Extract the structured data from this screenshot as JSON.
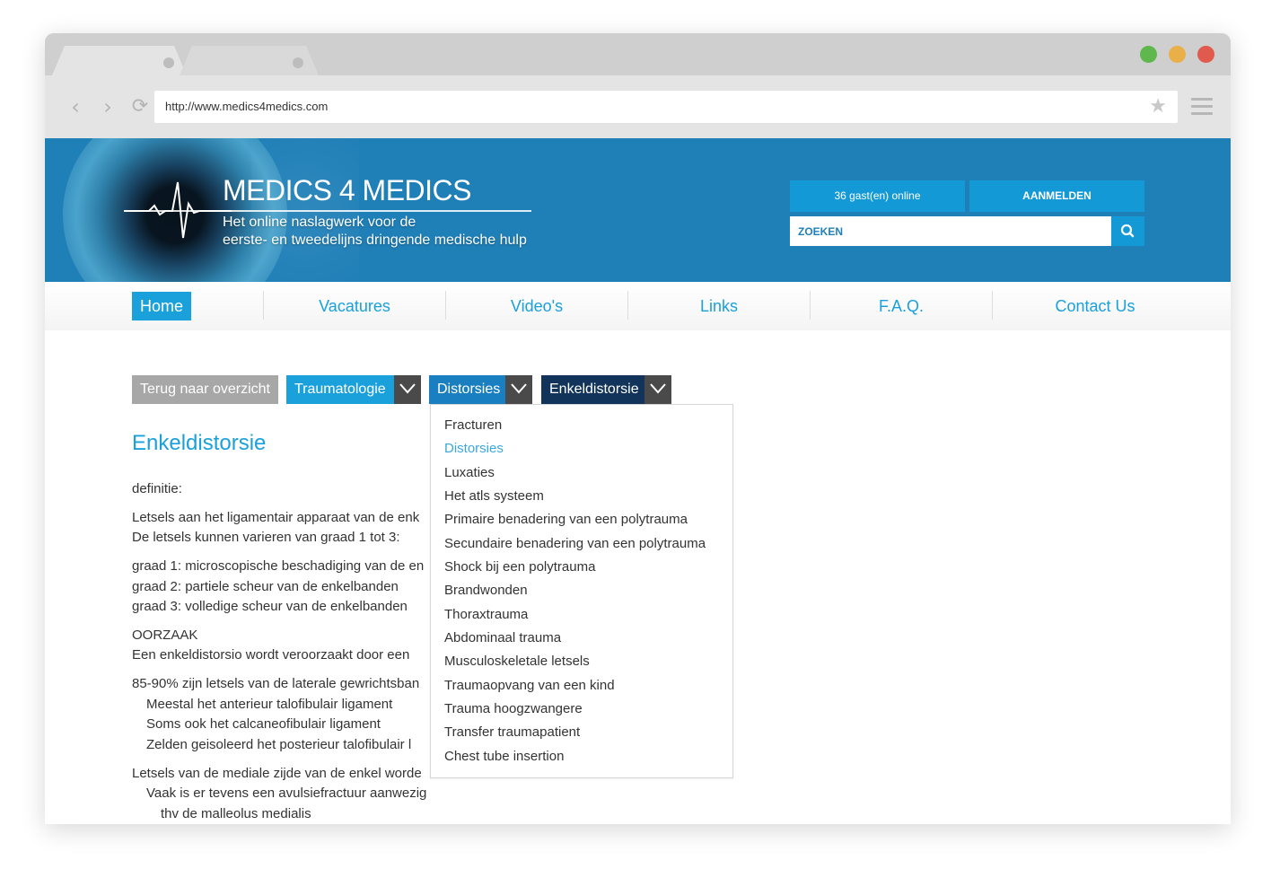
{
  "browser": {
    "url": "http://www.medics4medics.com",
    "traffic_lights": [
      "#5fb84e",
      "#e9b04a",
      "#e05a4d"
    ]
  },
  "header": {
    "logo_title": "MEDICS 4 MEDICS",
    "tagline_line1": "Het online naslagwerk voor de",
    "tagline_line2": "eerste- en tweedelijns dringende medische hulp",
    "guests_online": "36 gast(en) online",
    "login_label": "AANMELDEN",
    "search_placeholder": "ZOEKEN",
    "colors": {
      "bar": "#1f7fb7",
      "accent": "#1399d6"
    }
  },
  "nav": {
    "items": [
      "Home",
      "Vacatures",
      "Video's",
      "Links",
      "F.A.Q.",
      "Contact Us"
    ],
    "active": "Home"
  },
  "breadcrumbs": {
    "back": "Terug naar overzicht",
    "level1": "Traumatologie",
    "level2": "Distorsies",
    "level3": "Enkeldistorsie"
  },
  "dropdown": {
    "selected": "Distorsies",
    "options": [
      "Fracturen",
      "Distorsies",
      "Luxaties",
      "Het atls systeem",
      "Primaire benadering van een polytrauma",
      "Secundaire benadering van een polytrauma",
      "Shock bij een polytrauma",
      "Brandwonden",
      "Thoraxtrauma",
      "Abdominaal trauma",
      "Musculoskeletale letsels",
      "Traumaopvang van een kind",
      "Trauma hoogzwangere",
      "Transfer traumapatient",
      "Chest tube insertion"
    ]
  },
  "article": {
    "title": "Enkeldistorsie",
    "definitie_label": "definitie:",
    "p1_line1": "Letsels aan het ligamentair apparaat van de enk",
    "p1_line2": "De letsels kunnen varieren van graad 1 tot 3:",
    "grade1": "graad 1: microscopische beschadiging van de en",
    "grade2": "graad 2: partiele scheur van de enkelbanden",
    "grade3": "graad 3: volledige scheur van de enkelbanden",
    "oorzaak_label": "OORZAAK",
    "oorzaak_text": "Een enkeldistorsio wordt veroorzaakt door een",
    "lateral": "85-90% zijn letsels van de laterale gewrichtsban",
    "lateral_1": "Meestal het anterieur talofibulair ligament",
    "lateral_2": "Soms ook het calcaneofibulair ligament",
    "lateral_3": "Zelden geisoleerd het posterieur talofibulair l",
    "medial": "Letsels van de mediale zijde van de enkel worde",
    "medial_1": "Vaak is er tevens een avulsiefractuur aanwezig",
    "medial_2": "thv de malleolus medialis"
  }
}
